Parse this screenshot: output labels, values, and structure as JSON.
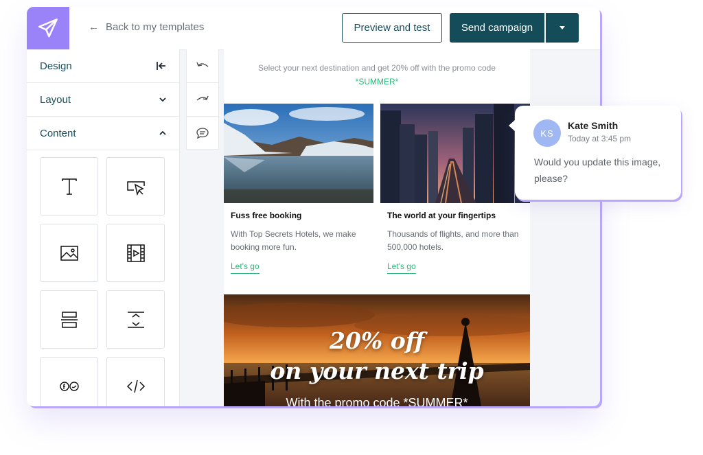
{
  "topbar": {
    "back_label": "Back to my templates",
    "preview_label": "Preview and test",
    "send_label": "Send campaign"
  },
  "sidebar": {
    "design_label": "Design",
    "layout_label": "Layout",
    "content_label": "Content",
    "blocks": [
      {
        "icon": "text-block-icon"
      },
      {
        "icon": "button-block-icon"
      },
      {
        "icon": "image-block-icon"
      },
      {
        "icon": "video-block-icon"
      },
      {
        "icon": "divider-block-icon"
      },
      {
        "icon": "spacer-block-icon"
      },
      {
        "icon": "social-block-icon"
      },
      {
        "icon": "html-block-icon"
      }
    ]
  },
  "tools": [
    {
      "icon": "undo-icon"
    },
    {
      "icon": "redo-icon"
    },
    {
      "icon": "comment-icon"
    }
  ],
  "email": {
    "promo_text": "Select your next destination and get 20% off with the promo code",
    "promo_code": "*SUMMER*",
    "cards": [
      {
        "title": "Fuss free booking",
        "text": "With Top Secrets Hotels, we make booking more fun.",
        "link": "Let's go"
      },
      {
        "title": "The world at your fingertips",
        "text": "Thousands of flights, and more than 500,000 hotels.",
        "link": "Let's go"
      }
    ],
    "banner": {
      "line1": "20% off",
      "line2": "on your next trip",
      "line3": "With the promo code *SUMMER*"
    }
  },
  "comment": {
    "initials": "KS",
    "name": "Kate Smith",
    "time": "Today at 3:45 pm",
    "message": "Would you update this image, please?"
  },
  "colors": {
    "brand_purple": "#9a83f8",
    "teal_dark": "#154c5a",
    "link_green": "#2bb87a",
    "avatar_blue": "#9fb8f4"
  }
}
